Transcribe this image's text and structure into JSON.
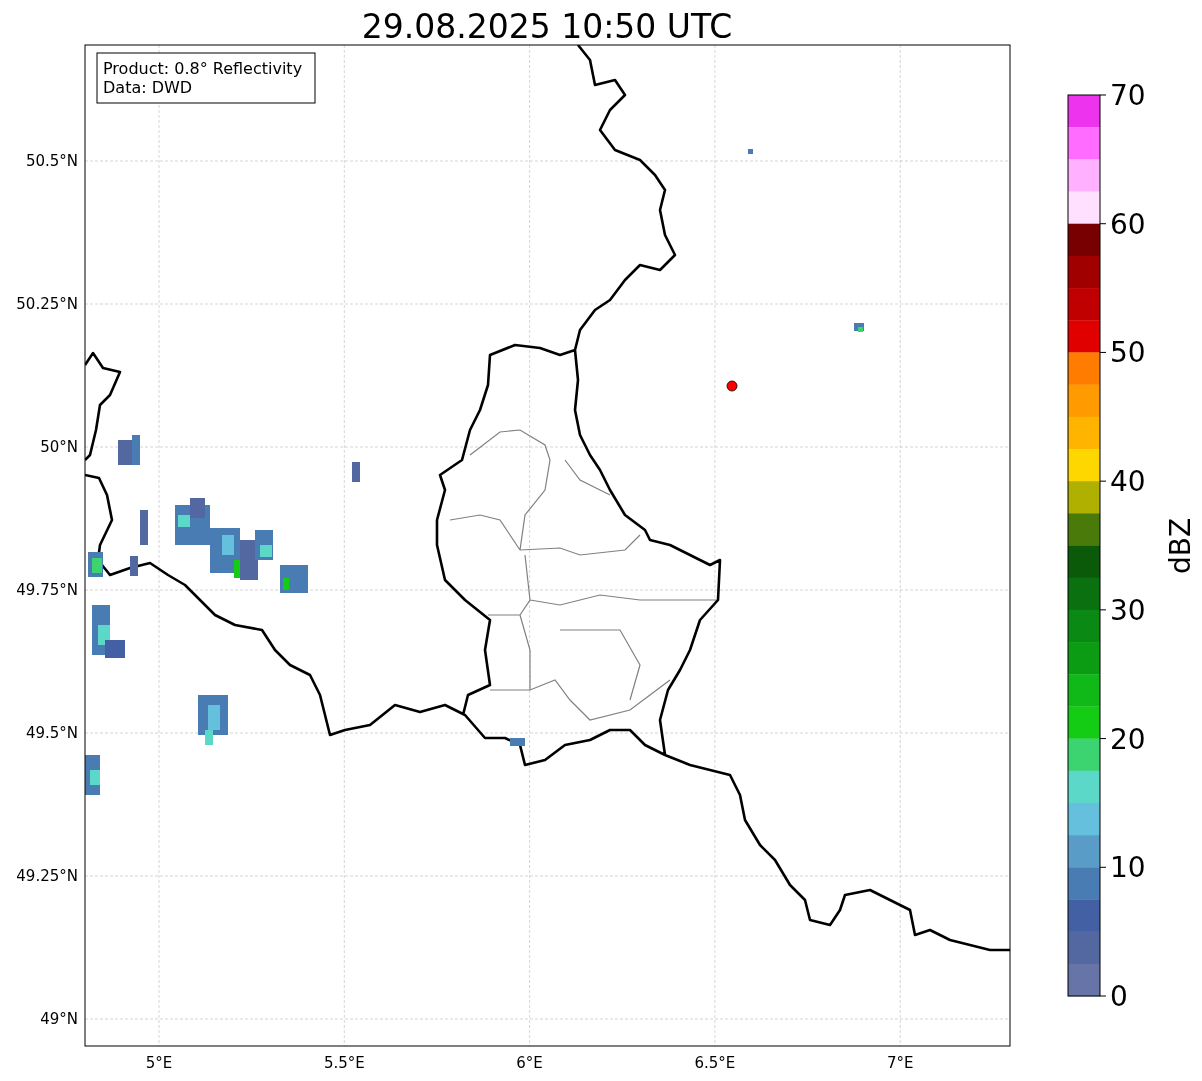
{
  "title": "29.08.2025 10:50 UTC",
  "info_box": {
    "lines": [
      "Product: 0.8° Reflectivity",
      "Data: DWD"
    ]
  },
  "map": {
    "x_ticks": [
      "5°E",
      "5.5°E",
      "6°E",
      "6.5°E",
      "7°E"
    ],
    "y_ticks": [
      "50.5°N",
      "50.25°N",
      "50°N",
      "49.75°N",
      "49.5°N",
      "49.25°N",
      "49°N"
    ]
  },
  "colorbar": {
    "label": "dBZ",
    "ticks": [
      "70",
      "60",
      "50",
      "40",
      "30",
      "20",
      "10",
      "0"
    ],
    "bands": [
      {
        "color": "#ee33ee"
      },
      {
        "color": "#ff6cff"
      },
      {
        "color": "#ffb0ff"
      },
      {
        "color": "#ffe0ff"
      },
      {
        "color": "#780000"
      },
      {
        "color": "#a00000"
      },
      {
        "color": "#c00000"
      },
      {
        "color": "#e00000"
      },
      {
        "color": "#ff7c00"
      },
      {
        "color": "#ff9a00"
      },
      {
        "color": "#ffb400"
      },
      {
        "color": "#ffd700"
      },
      {
        "color": "#b0b000"
      },
      {
        "color": "#4a7a0a"
      },
      {
        "color": "#0a5a0a"
      },
      {
        "color": "#0a7010"
      },
      {
        "color": "#0a8a14"
      },
      {
        "color": "#0c9c14"
      },
      {
        "color": "#10b818"
      },
      {
        "color": "#14cc14"
      },
      {
        "color": "#3cd470"
      },
      {
        "color": "#5cd8c8"
      },
      {
        "color": "#64c0dc"
      },
      {
        "color": "#5a9cc8"
      },
      {
        "color": "#4a7cb4"
      },
      {
        "color": "#4360a4"
      },
      {
        "color": "#5368a0"
      },
      {
        "color": "#6674a8"
      }
    ]
  }
}
